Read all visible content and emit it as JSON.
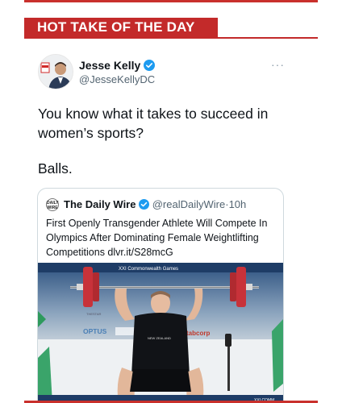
{
  "banner": {
    "title": "HOT TAKE OF THE DAY"
  },
  "tweet": {
    "author_name": "Jesse Kelly",
    "author_handle": "@JesseKellyDC",
    "text_line_1": "You know what it takes to succeed in women’s sports?",
    "text_line_2": "Balls.",
    "more_icon": "more-horizontal-icon"
  },
  "quote": {
    "logo_text": "DAILY WIRE",
    "author_name": "The Daily Wire",
    "author_handle": "@realDailyWire",
    "separator": "·",
    "time": "10h",
    "text": "First Openly Transgender Athlete Will Compete In Olympics After Dominating Female Weightlifting Competitions dlvr.it/S28mcG",
    "photo": {
      "banner_text": "XXI Commonwealth Games",
      "sponsor_1": "OPTUS",
      "sponsor_2": "tabcorp",
      "shirt_text": "NEW ZEALAND",
      "footer_text": "XXI COMM",
      "side_text": "THESTAR"
    }
  },
  "colors": {
    "banner": "#c32a2a",
    "verified": "#1d9bf0",
    "link": "#1d9bf0"
  }
}
